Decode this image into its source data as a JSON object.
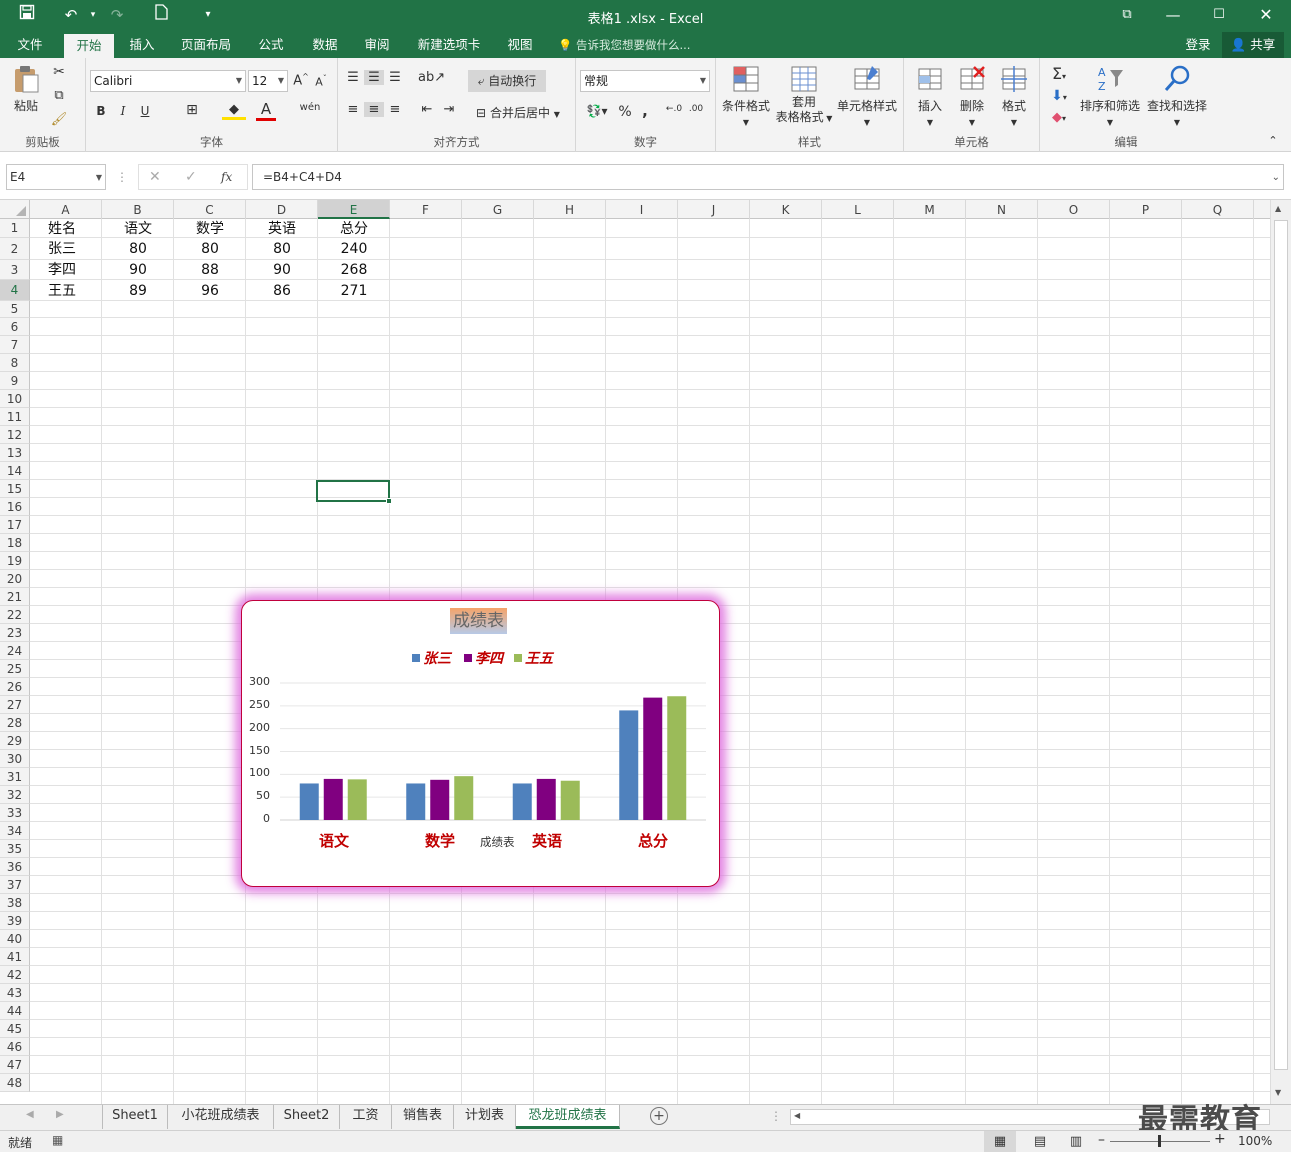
{
  "window": {
    "title": "表格1 .xlsx - Excel"
  },
  "ribbon_tabs": [
    "文件",
    "开始",
    "插入",
    "页面布局",
    "公式",
    "数据",
    "审阅",
    "新建选项卡",
    "视图"
  ],
  "tell_me": "告诉我您想要做什么...",
  "account": {
    "login": "登录",
    "share": "共享"
  },
  "ribbon": {
    "clipboard": {
      "paste": "粘贴",
      "label": "剪贴板"
    },
    "font": {
      "name": "Calibri",
      "size": "12",
      "bold": "B",
      "italic": "I",
      "underline": "U",
      "label": "字体"
    },
    "align": {
      "wrap": "自动换行",
      "merge": "合并后居中",
      "label": "对齐方式"
    },
    "number": {
      "format": "常规",
      "percent": "%",
      "comma": ",",
      "label": "数字"
    },
    "styles": {
      "cond": "条件格式",
      "table_1": "套用",
      "table_2": "表格格式",
      "cell": "单元格样式",
      "label": "样式"
    },
    "cells": {
      "insert": "插入",
      "delete": "删除",
      "format": "格式",
      "label": "单元格"
    },
    "editing": {
      "sort": "排序和筛选",
      "find": "查找和选择",
      "label": "编辑"
    }
  },
  "formula_bar": {
    "name_box": "E4",
    "fx": "fx",
    "formula": "=B4+C4+D4"
  },
  "columns": [
    "A",
    "B",
    "C",
    "D",
    "E",
    "F",
    "G",
    "H",
    "I",
    "J",
    "K",
    "L",
    "M",
    "N",
    "O",
    "P",
    "Q"
  ],
  "selected": {
    "col": "E",
    "row": 4
  },
  "cells": [
    [
      "姓名",
      "语文",
      "数学",
      "英语",
      "总分"
    ],
    [
      "张三",
      "80",
      "80",
      "80",
      "240"
    ],
    [
      "李四",
      "90",
      "88",
      "90",
      "268"
    ],
    [
      "王五",
      "89",
      "96",
      "86",
      "271"
    ]
  ],
  "row_count": 48,
  "chart_data": {
    "type": "bar",
    "title": "成绩表",
    "categories": [
      "语文",
      "数学",
      "英语",
      "总分"
    ],
    "series": [
      {
        "name": "张三",
        "values": [
          80,
          80,
          80,
          240
        ],
        "color": "#4f81bd"
      },
      {
        "name": "李四",
        "values": [
          90,
          88,
          90,
          268
        ],
        "color": "#800080"
      },
      {
        "name": "王五",
        "values": [
          89,
          96,
          86,
          271
        ],
        "color": "#9bbb59"
      }
    ],
    "xlabel": "成绩表",
    "ylim": [
      0,
      300
    ],
    "yticks": [
      0,
      50,
      100,
      150,
      200,
      250,
      300
    ],
    "legend": "top",
    "grid": true
  },
  "sheets": [
    "Sheet1",
    "小花班成绩表",
    "Sheet2",
    "工资",
    "销售表",
    "计划表",
    "恐龙班成绩表"
  ],
  "active_sheet": "恐龙班成绩表",
  "status": {
    "ready": "就绪",
    "zoom": "100%"
  },
  "watermark": "最需教育"
}
